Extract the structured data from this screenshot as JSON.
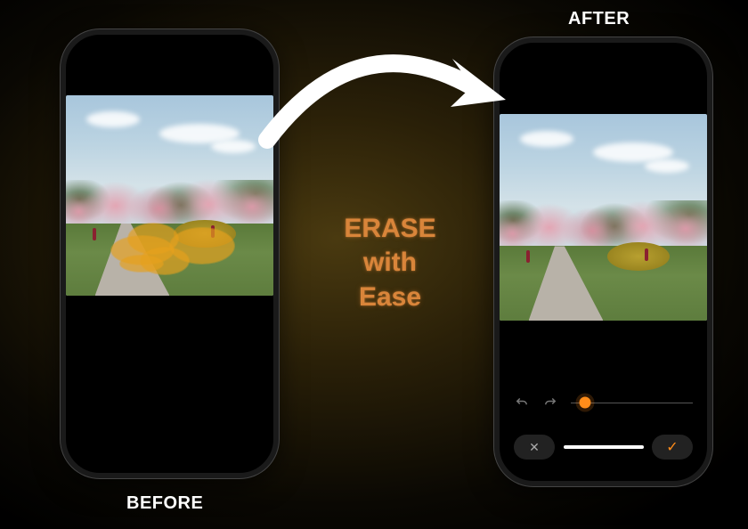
{
  "labels": {
    "before": "BEFORE",
    "after": "AFTER"
  },
  "tagline": {
    "line1": "ERASE",
    "line2": "with",
    "line3": "Ease"
  },
  "controls": {
    "slider_value_percent": 12,
    "cancel": "✕",
    "confirm": "✓"
  },
  "colors": {
    "accent": "#ff8c1a",
    "tagline": "#d9853a"
  }
}
